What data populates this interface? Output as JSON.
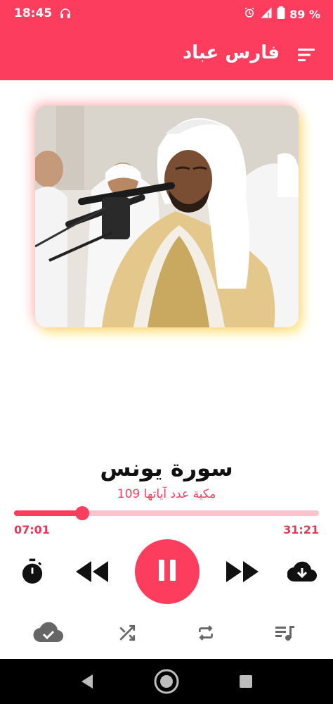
{
  "status": {
    "time": "18:45",
    "battery": "89 %"
  },
  "app_bar": {
    "title": "فارس عباد"
  },
  "track": {
    "title": "سورة يونس",
    "subtitle": "مكية عدد آياتها 109"
  },
  "player": {
    "elapsed": "07:01",
    "total": "31:21",
    "progress_fraction": 0.224,
    "state": "playing"
  },
  "icons": {
    "menu": "sort-menu-icon",
    "timer": "stopwatch-icon",
    "prev": "rewind-icon",
    "pause": "pause-icon",
    "next": "fast-forward-icon",
    "download": "cloud-download-icon",
    "cloud_done": "cloud-done-icon",
    "shuffle": "shuffle-icon",
    "repeat": "repeat-icon",
    "playlist": "queue-music-icon"
  },
  "colors": {
    "accent": "#fd3d5e",
    "track_light": "#fbc3cd",
    "icon_dark": "#111111",
    "icon_gray": "#555555"
  }
}
